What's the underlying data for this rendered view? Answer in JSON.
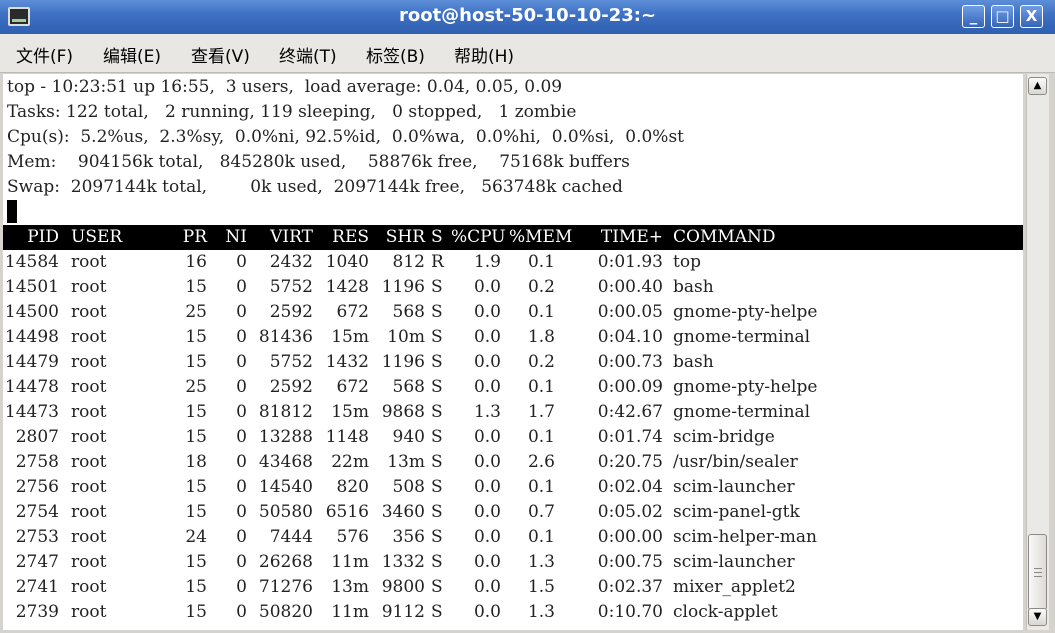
{
  "window": {
    "title": "root@host-50-10-10-23:~"
  },
  "window_buttons": {
    "minimize": "_",
    "maximize": "□",
    "close": "X"
  },
  "menu": [
    "文件(F)",
    "编辑(E)",
    "查看(V)",
    "终端(T)",
    "标签(B)",
    "帮助(H)"
  ],
  "top_summary": [
    "top - 10:23:51 up 16:55,  3 users,  load average: 0.04, 0.05, 0.09",
    "Tasks: 122 total,   2 running, 119 sleeping,   0 stopped,   1 zombie",
    "Cpu(s):  5.2%us,  2.3%sy,  0.0%ni, 92.5%id,  0.0%wa,  0.0%hi,  0.0%si,  0.0%st",
    "Mem:    904156k total,   845280k used,    58876k free,    75168k buffers",
    "Swap:  2097144k total,        0k used,  2097144k free,   563748k cached"
  ],
  "process_table": {
    "columns": [
      "PID",
      "USER",
      "PR",
      "NI",
      "VIRT",
      "RES",
      "SHR",
      "S",
      "%CPU",
      "%MEM",
      "TIME+",
      "COMMAND"
    ],
    "rows": [
      [
        "14584",
        "root",
        "16",
        "0",
        "2432",
        "1040",
        "812",
        "R",
        "1.9",
        "0.1",
        "0:01.93",
        "top"
      ],
      [
        "14501",
        "root",
        "15",
        "0",
        "5752",
        "1428",
        "1196",
        "S",
        "0.0",
        "0.2",
        "0:00.40",
        "bash"
      ],
      [
        "14500",
        "root",
        "25",
        "0",
        "2592",
        "672",
        "568",
        "S",
        "0.0",
        "0.1",
        "0:00.05",
        "gnome-pty-helpe"
      ],
      [
        "14498",
        "root",
        "15",
        "0",
        "81436",
        "15m",
        "10m",
        "S",
        "0.0",
        "1.8",
        "0:04.10",
        "gnome-terminal"
      ],
      [
        "14479",
        "root",
        "15",
        "0",
        "5752",
        "1432",
        "1196",
        "S",
        "0.0",
        "0.2",
        "0:00.73",
        "bash"
      ],
      [
        "14478",
        "root",
        "25",
        "0",
        "2592",
        "672",
        "568",
        "S",
        "0.0",
        "0.1",
        "0:00.09",
        "gnome-pty-helpe"
      ],
      [
        "14473",
        "root",
        "15",
        "0",
        "81812",
        "15m",
        "9868",
        "S",
        "1.3",
        "1.7",
        "0:42.67",
        "gnome-terminal"
      ],
      [
        "2807",
        "root",
        "15",
        "0",
        "13288",
        "1148",
        "940",
        "S",
        "0.0",
        "0.1",
        "0:01.74",
        "scim-bridge"
      ],
      [
        "2758",
        "root",
        "18",
        "0",
        "43468",
        "22m",
        "13m",
        "S",
        "0.0",
        "2.6",
        "0:20.75",
        "/usr/bin/sealer"
      ],
      [
        "2756",
        "root",
        "15",
        "0",
        "14540",
        "820",
        "508",
        "S",
        "0.0",
        "0.1",
        "0:02.04",
        "scim-launcher"
      ],
      [
        "2754",
        "root",
        "15",
        "0",
        "50580",
        "6516",
        "3460",
        "S",
        "0.0",
        "0.7",
        "0:05.02",
        "scim-panel-gtk"
      ],
      [
        "2753",
        "root",
        "24",
        "0",
        "7444",
        "576",
        "356",
        "S",
        "0.0",
        "0.1",
        "0:00.00",
        "scim-helper-man"
      ],
      [
        "2747",
        "root",
        "15",
        "0",
        "26268",
        "11m",
        "1332",
        "S",
        "0.0",
        "1.3",
        "0:00.75",
        "scim-launcher"
      ],
      [
        "2741",
        "root",
        "15",
        "0",
        "71276",
        "13m",
        "9800",
        "S",
        "0.0",
        "1.5",
        "0:02.37",
        "mixer_applet2"
      ],
      [
        "2739",
        "root",
        "15",
        "0",
        "50820",
        "11m",
        "9112",
        "S",
        "0.0",
        "1.3",
        "0:10.70",
        "clock-applet"
      ]
    ]
  },
  "scrollbar": {
    "up_arrow": "▲",
    "down_arrow": "▼"
  }
}
